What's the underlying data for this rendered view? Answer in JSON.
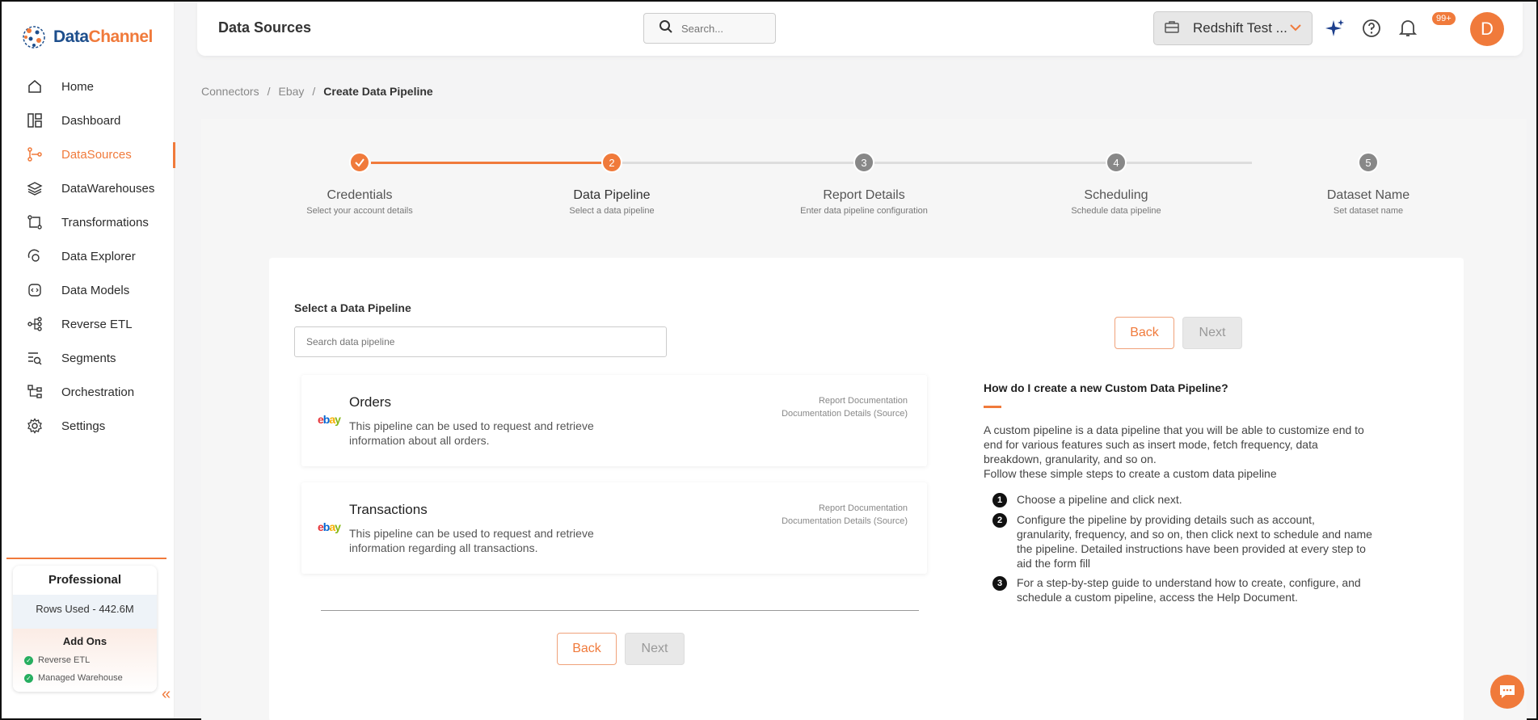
{
  "app": {
    "logo_part1": "Data",
    "logo_part2": "Channel"
  },
  "sidebar": {
    "items": [
      {
        "label": "Home",
        "icon": "home-icon"
      },
      {
        "label": "Dashboard",
        "icon": "dashboard-icon"
      },
      {
        "label": "DataSources",
        "icon": "datasources-icon",
        "active": true
      },
      {
        "label": "DataWarehouses",
        "icon": "layers-icon"
      },
      {
        "label": "Transformations",
        "icon": "transform-icon"
      },
      {
        "label": "Data Explorer",
        "icon": "explorer-icon"
      },
      {
        "label": "Data Models",
        "icon": "models-icon"
      },
      {
        "label": "Reverse ETL",
        "icon": "reverse-etl-icon"
      },
      {
        "label": "Segments",
        "icon": "segments-icon"
      },
      {
        "label": "Orchestration",
        "icon": "orchestration-icon"
      },
      {
        "label": "Settings",
        "icon": "gear-icon"
      }
    ],
    "plan": {
      "name": "Professional",
      "rows_used": "Rows Used - 442.6M",
      "addons_title": "Add Ons",
      "addons": [
        "Reverse ETL",
        "Managed Warehouse"
      ]
    }
  },
  "header": {
    "title": "Data Sources",
    "search_placeholder": "Search...",
    "workspace": "Redshift Test ...",
    "notifications": "99+",
    "avatar_initial": "D"
  },
  "breadcrumb": {
    "items": [
      "Connectors",
      "Ebay"
    ],
    "current": "Create Data Pipeline",
    "separator": "/"
  },
  "stepper": {
    "steps": [
      {
        "num": "",
        "label": "Credentials",
        "sub": "Select your account details",
        "state": "done"
      },
      {
        "num": "2",
        "label": "Data Pipeline",
        "sub": "Select a data pipeline",
        "state": "active"
      },
      {
        "num": "3",
        "label": "Report Details",
        "sub": "Enter data pipeline configuration",
        "state": "pending"
      },
      {
        "num": "4",
        "label": "Scheduling",
        "sub": "Schedule data pipeline",
        "state": "pending"
      },
      {
        "num": "5",
        "label": "Dataset Name",
        "sub": "Set dataset name",
        "state": "pending"
      }
    ]
  },
  "form": {
    "select_label": "Select a Data Pipeline",
    "search_placeholder": "Search data pipeline",
    "back_label": "Back",
    "next_label": "Next",
    "pipelines": [
      {
        "title": "Orders",
        "description": "This pipeline can be used to request and retrieve information about all orders.",
        "link1": "Report Documentation",
        "link2": "Documentation Details (Source)"
      },
      {
        "title": "Transactions",
        "description": "This pipeline can be used to request and retrieve information regarding all transactions.",
        "link1": "Report Documentation",
        "link2": "Documentation Details (Source)"
      }
    ]
  },
  "help": {
    "title": "How do I create a new Custom Data Pipeline?",
    "text": "A custom pipeline is a data pipeline that you will be able to customize end to end for various features such as insert mode, fetch frequency, data breakdown, granularity, and so on.",
    "text2": "Follow these simple steps to create a custom data pipeline",
    "steps": [
      {
        "num": "1",
        "text": "Choose a pipeline and click next."
      },
      {
        "num": "2",
        "text": "Configure the pipeline by providing details such as account, granularity, frequency, and so on, then click next to schedule and name the pipeline. Detailed instructions have been provided at every step to aid the form fill"
      },
      {
        "num": "3",
        "text": "For a step-by-step guide to understand how to create, configure, and schedule a custom pipeline, access the Help Document."
      }
    ]
  },
  "colors": {
    "accent": "#f07a3b",
    "pending": "#888888",
    "success": "#27ae60"
  }
}
